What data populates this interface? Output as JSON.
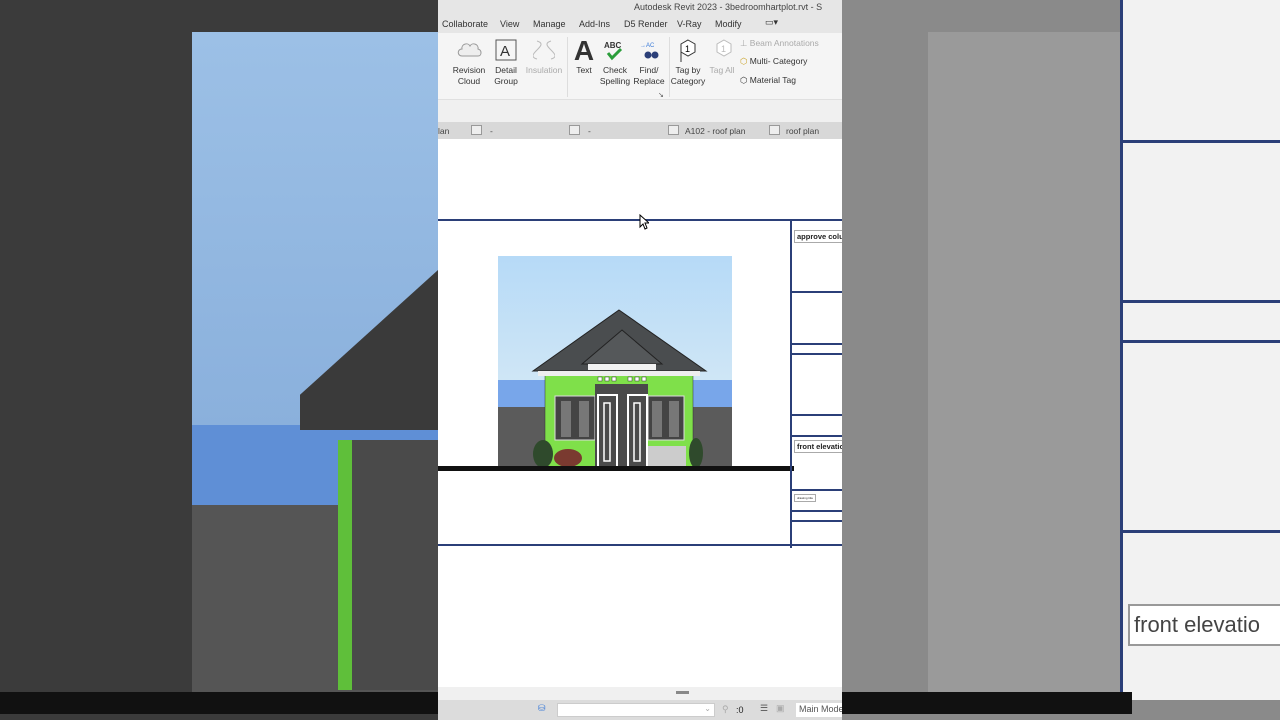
{
  "window": {
    "title": "Autodesk Revit 2023 - 3bedroomhartplot.rvt - S"
  },
  "tabs": [
    "Collaborate",
    "View",
    "Manage",
    "Add-Ins",
    "D5 Render",
    "V-Ray",
    "Modify"
  ],
  "ribbon": {
    "revision_cloud": "Revision Cloud",
    "detail_group": "Detail Group",
    "insulation": "Insulation",
    "text": "Text",
    "check_spelling": "Check Spelling",
    "find_replace": "Find/ Replace",
    "tag_by_category": "Tag by Category",
    "tag_all": "Tag All",
    "beam_annotations": "Beam  Annotations",
    "multi_category": "Multi- Category",
    "material_tag": "Material  Tag"
  },
  "view_tabs": [
    "lan",
    "-",
    "-",
    "A102 - roof plan",
    "roof plan"
  ],
  "sheet": {
    "label1": "approve colu",
    "label2": "front elevation",
    "label3": "drawing title"
  },
  "status": {
    "count": ":0",
    "model": "Main Model"
  },
  "background": {
    "label": "front elevatio"
  },
  "colors": {
    "accent": "#2b3f78",
    "wall_green": "#7fe04a",
    "roof": "#4a4d4f"
  }
}
